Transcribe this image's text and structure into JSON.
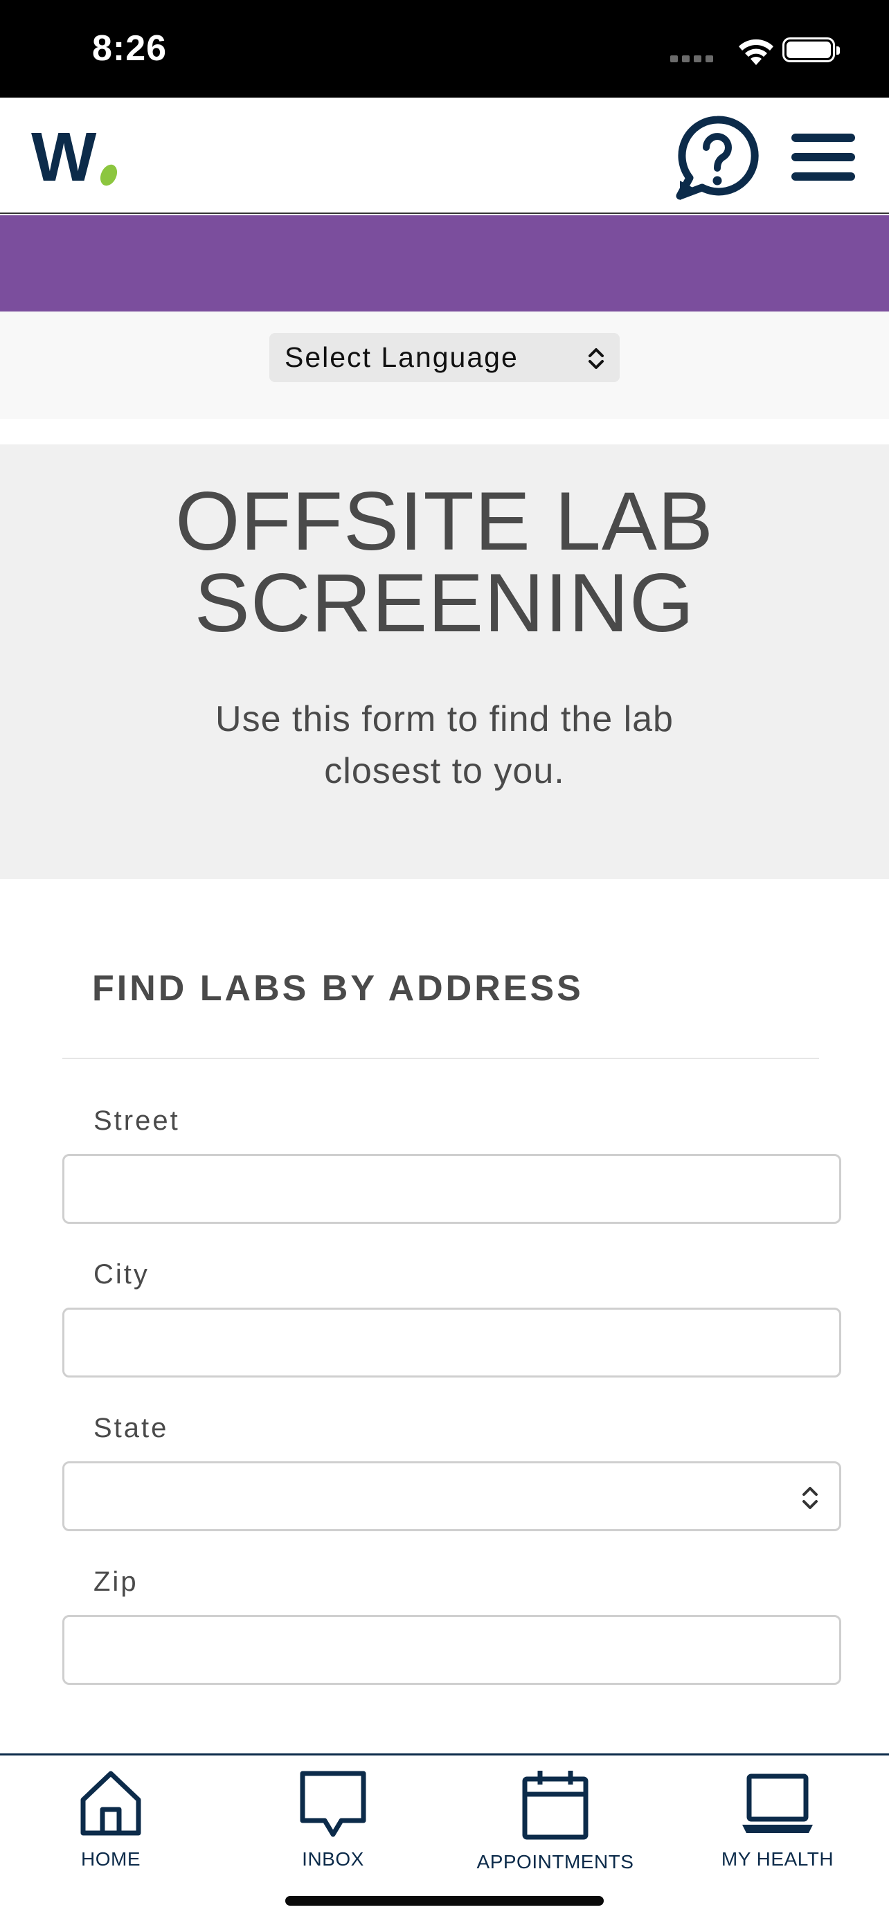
{
  "status_bar": {
    "time": "8:26"
  },
  "header": {
    "logo_text": "W"
  },
  "language": {
    "label": "Select Language"
  },
  "hero": {
    "title": "OFFSITE LAB SCREENING",
    "subtitle": "Use this form to find the lab closest to you."
  },
  "form": {
    "heading": "FIND LABS BY ADDRESS",
    "fields": [
      {
        "label": "Street",
        "value": ""
      },
      {
        "label": "City",
        "value": ""
      },
      {
        "label": "State",
        "value": ""
      },
      {
        "label": "Zip",
        "value": ""
      }
    ]
  },
  "tabs": [
    {
      "label": "HOME",
      "icon": "home-icon"
    },
    {
      "label": "INBOX",
      "icon": "inbox-icon"
    },
    {
      "label": "APPOINTMENTS",
      "icon": "calendar-icon"
    },
    {
      "label": "MY HEALTH",
      "icon": "laptop-icon"
    }
  ],
  "colors": {
    "brand_navy": "#0c2b4a",
    "brand_purple": "#7b4e9d",
    "logo_green": "#8cc63f"
  }
}
